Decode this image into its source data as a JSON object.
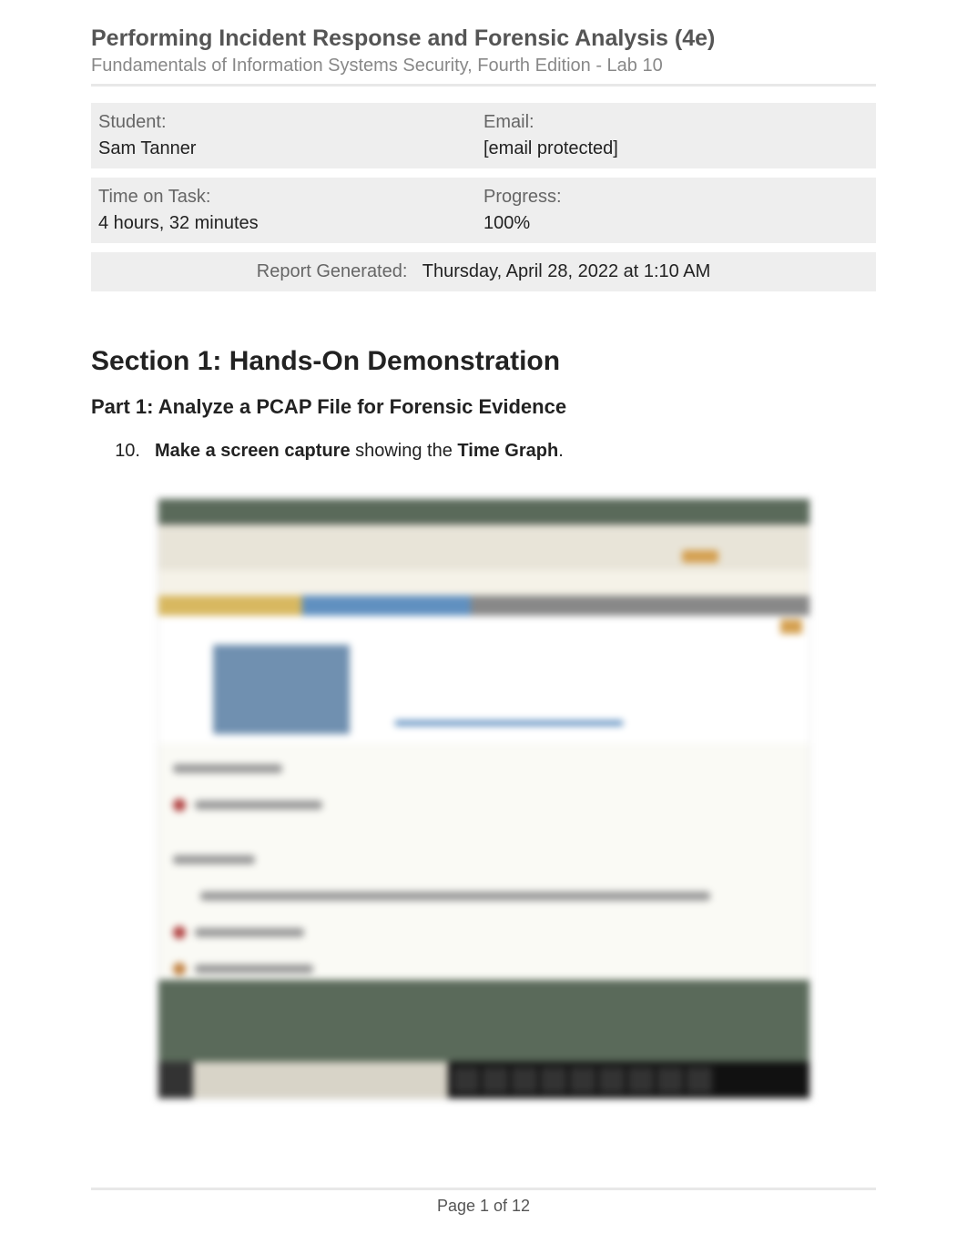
{
  "header": {
    "title": "Performing Incident Response and Forensic Analysis (4e)",
    "subtitle": "Fundamentals of Information Systems Security, Fourth Edition - Lab 10"
  },
  "info": {
    "student_label": "Student:",
    "student_value": "Sam Tanner",
    "email_label": "Email:",
    "email_value": "[email protected]",
    "time_label": "Time on Task:",
    "time_value": "4 hours, 32 minutes",
    "progress_label": "Progress:",
    "progress_value": "100%"
  },
  "report": {
    "label": "Report Generated:",
    "value": "Thursday, April 28, 2022 at 1:10 AM"
  },
  "section": {
    "title": "Section 1: Hands-On Demonstration",
    "part_title": "Part 1: Analyze a PCAP File for Forensic Evidence",
    "instruction_number": "10.",
    "instruction_bold_1": "Make a screen capture",
    "instruction_mid": " showing the ",
    "instruction_bold_2": "Time Graph",
    "instruction_end": "."
  },
  "footer": {
    "page": "Page 1 of 12"
  }
}
